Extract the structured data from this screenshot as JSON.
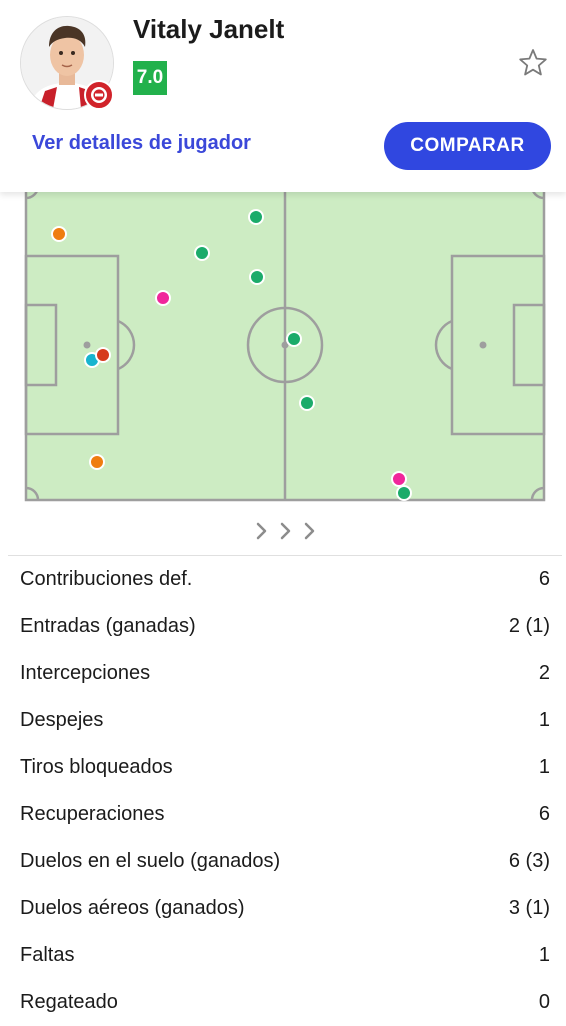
{
  "player": {
    "name": "Vitaly Janelt",
    "rating": "7.0",
    "rating_color": "#22b14c"
  },
  "icons": {
    "favorite": "star-outline-icon",
    "avatar": "player-photo",
    "badge": "brentford-crest",
    "carousel": "chevron-right-icon"
  },
  "actions": {
    "details_label": "Ver detalles de jugador",
    "compare_label": "COMPARAR"
  },
  "colors": {
    "accent": "#3047e0",
    "pitch": "#cdecc3",
    "line": "#9e9e9e",
    "green": "#1bab6a",
    "orange": "#ef7d10",
    "pink": "#f0269b",
    "red": "#d63a1e",
    "cyan": "#17b4cf"
  },
  "stats": [
    {
      "label": "Contribuciones def.",
      "value": "6"
    },
    {
      "label": "Entradas (ganadas)",
      "value": "2 (1)"
    },
    {
      "label": "Intercepciones",
      "value": "2"
    },
    {
      "label": "Despejes",
      "value": "1"
    },
    {
      "label": "Tiros bloqueados",
      "value": "1"
    },
    {
      "label": "Recuperaciones",
      "value": "6"
    },
    {
      "label": "Duelos en el suelo (ganados)",
      "value": "6 (3)"
    },
    {
      "label": "Duelos aéreos (ganados)",
      "value": "3 (1)"
    },
    {
      "label": "Faltas",
      "value": "1"
    },
    {
      "label": "Regateado",
      "value": "0"
    }
  ]
}
